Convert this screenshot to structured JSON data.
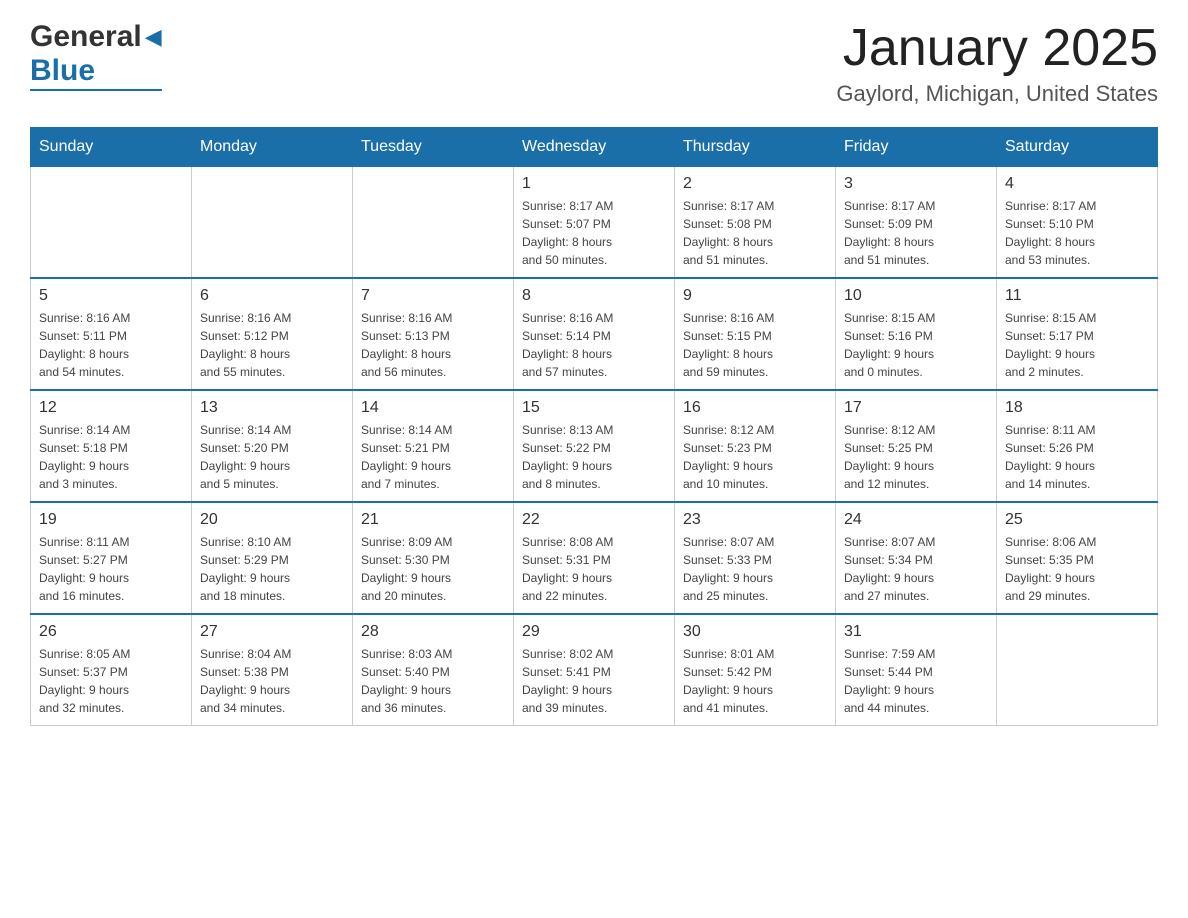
{
  "header": {
    "logo": {
      "general": "General",
      "blue": "Blue",
      "arrow": "▲"
    },
    "title": "January 2025",
    "location": "Gaylord, Michigan, United States"
  },
  "calendar": {
    "weekdays": [
      "Sunday",
      "Monday",
      "Tuesday",
      "Wednesday",
      "Thursday",
      "Friday",
      "Saturday"
    ],
    "weeks": [
      [
        {
          "day": "",
          "info": ""
        },
        {
          "day": "",
          "info": ""
        },
        {
          "day": "",
          "info": ""
        },
        {
          "day": "1",
          "info": "Sunrise: 8:17 AM\nSunset: 5:07 PM\nDaylight: 8 hours\nand 50 minutes."
        },
        {
          "day": "2",
          "info": "Sunrise: 8:17 AM\nSunset: 5:08 PM\nDaylight: 8 hours\nand 51 minutes."
        },
        {
          "day": "3",
          "info": "Sunrise: 8:17 AM\nSunset: 5:09 PM\nDaylight: 8 hours\nand 51 minutes."
        },
        {
          "day": "4",
          "info": "Sunrise: 8:17 AM\nSunset: 5:10 PM\nDaylight: 8 hours\nand 53 minutes."
        }
      ],
      [
        {
          "day": "5",
          "info": "Sunrise: 8:16 AM\nSunset: 5:11 PM\nDaylight: 8 hours\nand 54 minutes."
        },
        {
          "day": "6",
          "info": "Sunrise: 8:16 AM\nSunset: 5:12 PM\nDaylight: 8 hours\nand 55 minutes."
        },
        {
          "day": "7",
          "info": "Sunrise: 8:16 AM\nSunset: 5:13 PM\nDaylight: 8 hours\nand 56 minutes."
        },
        {
          "day": "8",
          "info": "Sunrise: 8:16 AM\nSunset: 5:14 PM\nDaylight: 8 hours\nand 57 minutes."
        },
        {
          "day": "9",
          "info": "Sunrise: 8:16 AM\nSunset: 5:15 PM\nDaylight: 8 hours\nand 59 minutes."
        },
        {
          "day": "10",
          "info": "Sunrise: 8:15 AM\nSunset: 5:16 PM\nDaylight: 9 hours\nand 0 minutes."
        },
        {
          "day": "11",
          "info": "Sunrise: 8:15 AM\nSunset: 5:17 PM\nDaylight: 9 hours\nand 2 minutes."
        }
      ],
      [
        {
          "day": "12",
          "info": "Sunrise: 8:14 AM\nSunset: 5:18 PM\nDaylight: 9 hours\nand 3 minutes."
        },
        {
          "day": "13",
          "info": "Sunrise: 8:14 AM\nSunset: 5:20 PM\nDaylight: 9 hours\nand 5 minutes."
        },
        {
          "day": "14",
          "info": "Sunrise: 8:14 AM\nSunset: 5:21 PM\nDaylight: 9 hours\nand 7 minutes."
        },
        {
          "day": "15",
          "info": "Sunrise: 8:13 AM\nSunset: 5:22 PM\nDaylight: 9 hours\nand 8 minutes."
        },
        {
          "day": "16",
          "info": "Sunrise: 8:12 AM\nSunset: 5:23 PM\nDaylight: 9 hours\nand 10 minutes."
        },
        {
          "day": "17",
          "info": "Sunrise: 8:12 AM\nSunset: 5:25 PM\nDaylight: 9 hours\nand 12 minutes."
        },
        {
          "day": "18",
          "info": "Sunrise: 8:11 AM\nSunset: 5:26 PM\nDaylight: 9 hours\nand 14 minutes."
        }
      ],
      [
        {
          "day": "19",
          "info": "Sunrise: 8:11 AM\nSunset: 5:27 PM\nDaylight: 9 hours\nand 16 minutes."
        },
        {
          "day": "20",
          "info": "Sunrise: 8:10 AM\nSunset: 5:29 PM\nDaylight: 9 hours\nand 18 minutes."
        },
        {
          "day": "21",
          "info": "Sunrise: 8:09 AM\nSunset: 5:30 PM\nDaylight: 9 hours\nand 20 minutes."
        },
        {
          "day": "22",
          "info": "Sunrise: 8:08 AM\nSunset: 5:31 PM\nDaylight: 9 hours\nand 22 minutes."
        },
        {
          "day": "23",
          "info": "Sunrise: 8:07 AM\nSunset: 5:33 PM\nDaylight: 9 hours\nand 25 minutes."
        },
        {
          "day": "24",
          "info": "Sunrise: 8:07 AM\nSunset: 5:34 PM\nDaylight: 9 hours\nand 27 minutes."
        },
        {
          "day": "25",
          "info": "Sunrise: 8:06 AM\nSunset: 5:35 PM\nDaylight: 9 hours\nand 29 minutes."
        }
      ],
      [
        {
          "day": "26",
          "info": "Sunrise: 8:05 AM\nSunset: 5:37 PM\nDaylight: 9 hours\nand 32 minutes."
        },
        {
          "day": "27",
          "info": "Sunrise: 8:04 AM\nSunset: 5:38 PM\nDaylight: 9 hours\nand 34 minutes."
        },
        {
          "day": "28",
          "info": "Sunrise: 8:03 AM\nSunset: 5:40 PM\nDaylight: 9 hours\nand 36 minutes."
        },
        {
          "day": "29",
          "info": "Sunrise: 8:02 AM\nSunset: 5:41 PM\nDaylight: 9 hours\nand 39 minutes."
        },
        {
          "day": "30",
          "info": "Sunrise: 8:01 AM\nSunset: 5:42 PM\nDaylight: 9 hours\nand 41 minutes."
        },
        {
          "day": "31",
          "info": "Sunrise: 7:59 AM\nSunset: 5:44 PM\nDaylight: 9 hours\nand 44 minutes."
        },
        {
          "day": "",
          "info": ""
        }
      ]
    ]
  }
}
